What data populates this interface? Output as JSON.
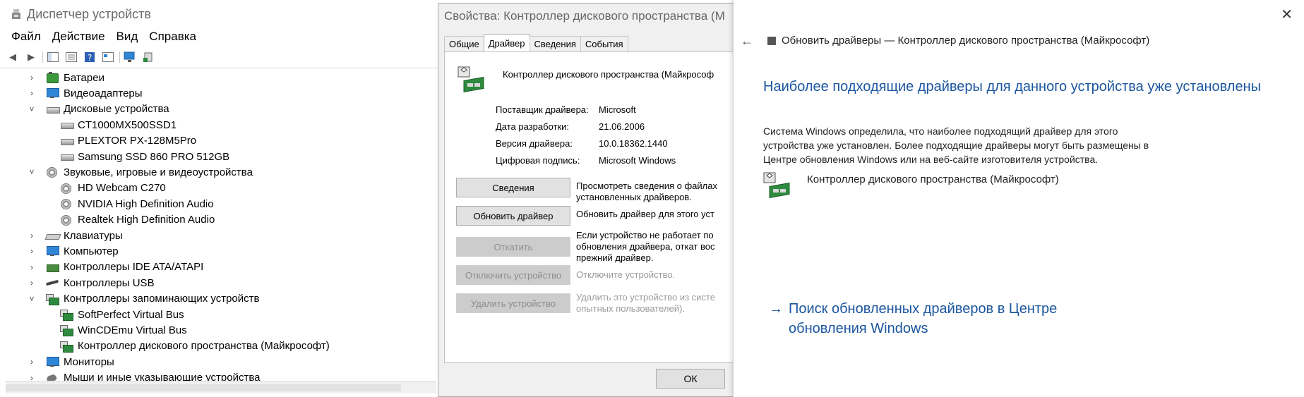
{
  "device_manager": {
    "title": "Диспетчер устройств",
    "menu": [
      "Файл",
      "Действие",
      "Вид",
      "Справка"
    ],
    "tree": [
      {
        "label": "Батареи",
        "icon": "battery-icon",
        "level": 0,
        "expand": "collapsed"
      },
      {
        "label": "Видеоадаптеры",
        "icon": "monitor-icon",
        "level": 0,
        "expand": "collapsed"
      },
      {
        "label": "Дисковые устройства",
        "icon": "disk-icon",
        "level": 0,
        "expand": "expanded"
      },
      {
        "label": "CT1000MX500SSD1",
        "icon": "disk-icon",
        "level": 1
      },
      {
        "label": "PLEXTOR PX-128M5Pro",
        "icon": "disk-icon",
        "level": 1
      },
      {
        "label": "Samsung SSD 860 PRO 512GB",
        "icon": "disk-icon",
        "level": 1
      },
      {
        "label": "Звуковые, игровые и видеоустройства",
        "icon": "speaker-icon",
        "level": 0,
        "expand": "expanded"
      },
      {
        "label": "HD Webcam C270",
        "icon": "speaker-icon",
        "level": 1
      },
      {
        "label": "NVIDIA High Definition Audio",
        "icon": "speaker-icon",
        "level": 1
      },
      {
        "label": "Realtek High Definition Audio",
        "icon": "speaker-icon",
        "level": 1
      },
      {
        "label": "Клавиатуры",
        "icon": "keyboard-icon",
        "level": 0,
        "expand": "collapsed"
      },
      {
        "label": "Компьютер",
        "icon": "monitor-icon",
        "level": 0,
        "expand": "collapsed"
      },
      {
        "label": "Контроллеры IDE ATA/ATAPI",
        "icon": "ide-controller-icon",
        "level": 0,
        "expand": "collapsed"
      },
      {
        "label": "Контроллеры USB",
        "icon": "usb-icon",
        "level": 0,
        "expand": "collapsed"
      },
      {
        "label": "Контроллеры запоминающих устройств",
        "icon": "storage-controller-icon",
        "level": 0,
        "expand": "expanded"
      },
      {
        "label": "SoftPerfect Virtual Bus",
        "icon": "storage-controller-icon",
        "level": 1
      },
      {
        "label": "WinCDEmu Virtual Bus",
        "icon": "storage-controller-icon",
        "level": 1
      },
      {
        "label": "Контроллер дискового пространства (Майкрософт)",
        "icon": "storage-controller-icon",
        "level": 1
      },
      {
        "label": "Мониторы",
        "icon": "monitor-icon",
        "level": 0,
        "expand": "collapsed"
      },
      {
        "label": "Мыши и иные указывающие устройства",
        "icon": "mouse-icon",
        "level": 0,
        "expand": "collapsed"
      }
    ]
  },
  "properties": {
    "title": "Свойства: Контроллер дискового пространства (М",
    "tabs": [
      "Общие",
      "Драйвер",
      "Сведения",
      "События"
    ],
    "active_tab": "Драйвер",
    "device_name": "Контроллер дискового пространства (Майкрософ",
    "fields": [
      {
        "label": "Поставщик драйвера:",
        "value": "Microsoft"
      },
      {
        "label": "Дата разработки:",
        "value": "21.06.2006"
      },
      {
        "label": "Версия драйвера:",
        "value": "10.0.18362.1440"
      },
      {
        "label": "Цифровая подпись:",
        "value": "Microsoft Windows"
      }
    ],
    "buttons": [
      {
        "label": "Сведения",
        "desc": [
          "Просмотреть сведения о файлах",
          "установленных драйверов."
        ],
        "enabled": true
      },
      {
        "label": "Обновить драйвер",
        "desc": [
          "Обновить драйвер для этого уст"
        ],
        "enabled": true
      },
      {
        "label": "Откатить",
        "desc": [
          "Если устройство не работает по",
          "обновления драйвера, откат вос",
          "прежний драйвер."
        ],
        "enabled": false
      },
      {
        "label": "Отключить устройство",
        "desc": [
          "Отключите устройство."
        ],
        "enabled": false
      },
      {
        "label": "Удалить устройство",
        "desc": [
          "Удалить это устройство из систе",
          "опытных пользователей)."
        ],
        "enabled": false
      }
    ],
    "ok_label": "ОК"
  },
  "update_panel": {
    "header": "Обновить драйверы — Контроллер дискового пространства (Майкрософт)",
    "heading": "Наиболее подходящие драйверы для данного устройства уже установлены",
    "body_lines": [
      "Система Windows определила, что наиболее подходящий драйвер для этого",
      "устройства уже установлен. Более подходящие драйверы могут быть размещены в",
      "Центре обновления Windows или на веб-сайте изготовителя устройства."
    ],
    "device_name": "Контроллер дискового пространства (Майкрософт)",
    "link_lines": [
      "Поиск обновленных драйверов в Центре",
      "обновления Windows"
    ],
    "close_icon": "close-icon",
    "back_icon": "back-arrow-icon"
  }
}
